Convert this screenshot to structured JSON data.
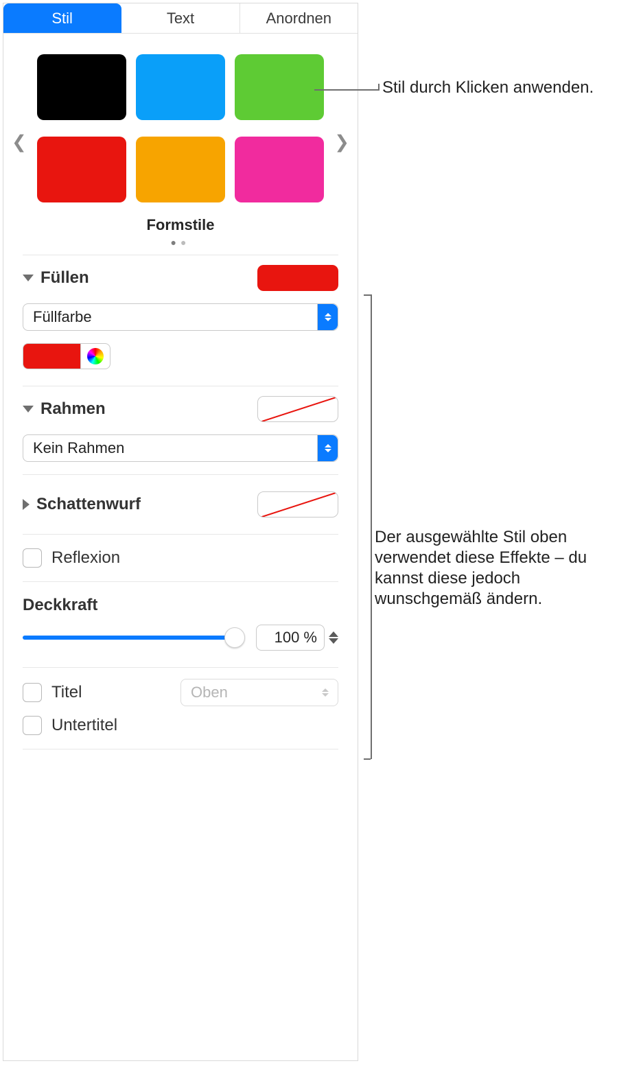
{
  "tabs": {
    "style": "Stil",
    "text": "Text",
    "arrange": "Anordnen",
    "active": "style"
  },
  "presets": {
    "caption": "Formstile",
    "colors": {
      "black": "#000000",
      "blue": "#0a9ff9",
      "green": "#5ecb34",
      "red": "#e8150f",
      "orange": "#f7a400",
      "pink": "#f12b9e"
    }
  },
  "fill": {
    "label": "Füllen",
    "type": "Füllfarbe",
    "color": "#e8150f"
  },
  "border": {
    "label": "Rahmen",
    "type": "Kein Rahmen"
  },
  "shadow": {
    "label": "Schattenwurf"
  },
  "reflection": {
    "label": "Reflexion",
    "checked": false
  },
  "opacity": {
    "label": "Deckkraft",
    "value_text": "100 %",
    "value": 100
  },
  "title": {
    "title_label": "Titel",
    "subtitle_label": "Untertitel",
    "position_label": "Oben",
    "title_checked": false,
    "subtitle_checked": false
  },
  "callouts": {
    "apply": "Stil durch Klicken anwenden.",
    "effects": "Der ausgewählte Stil oben verwendet diese Effekte – du kannst diese jedoch wunschgemäß ändern."
  }
}
